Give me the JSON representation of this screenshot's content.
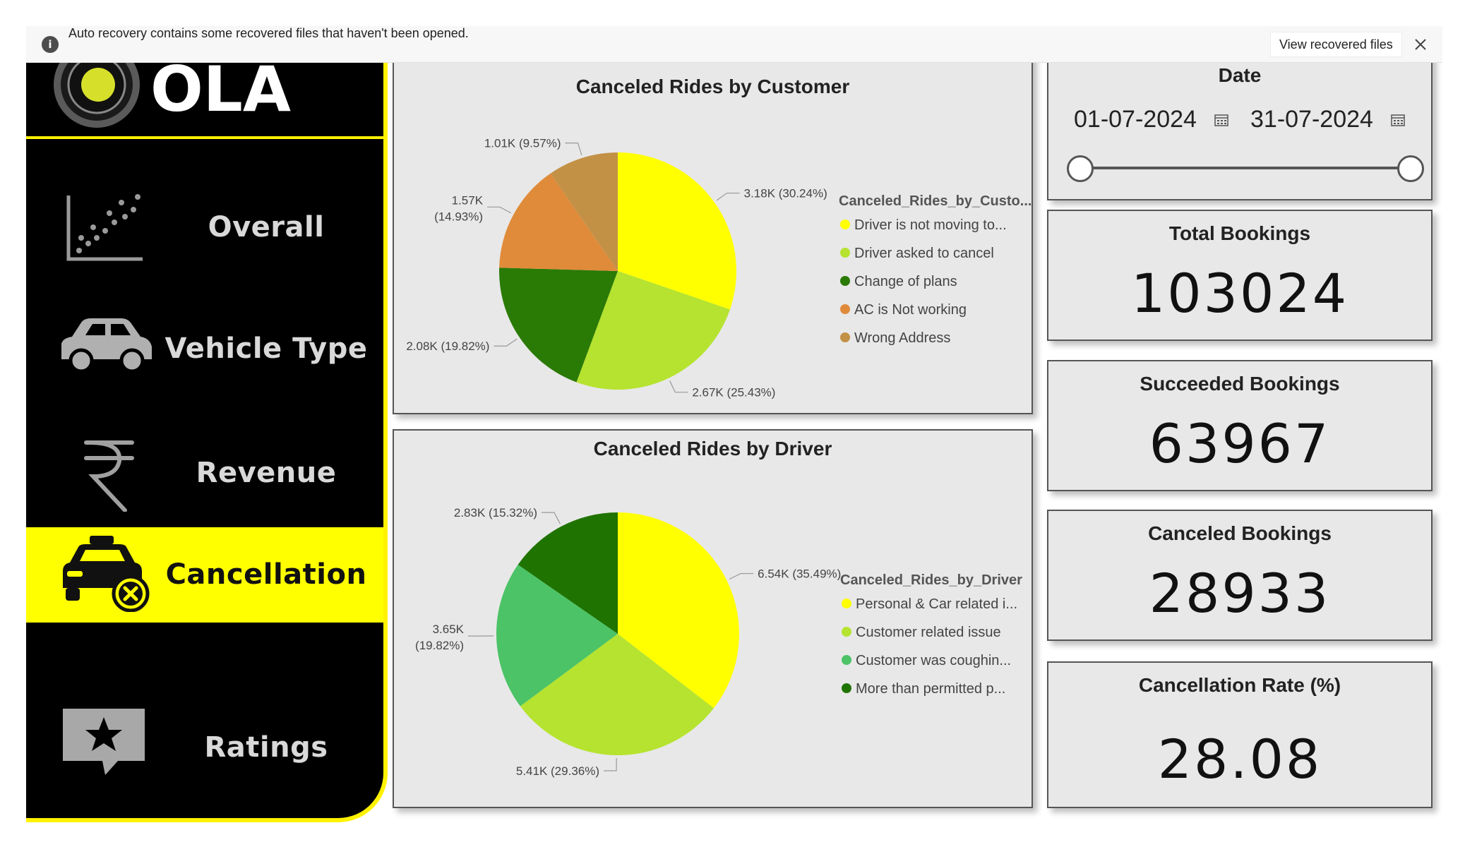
{
  "notification": {
    "message": "Auto recovery contains some recovered files that haven't been opened.",
    "view_button": "View recovered files",
    "info_glyph": "i"
  },
  "sidebar": {
    "brand": "OLA",
    "items": [
      {
        "label": "Overall",
        "icon": "scatter-chart-icon",
        "active": false
      },
      {
        "label": "Vehicle Type",
        "icon": "car-icon",
        "active": false
      },
      {
        "label": "Revenue",
        "icon": "rupee-icon",
        "active": false
      },
      {
        "label": "Cancellation",
        "icon": "taxi-cancel-icon",
        "active": true
      },
      {
        "label": "Ratings",
        "icon": "star-speech-bubble-icon",
        "active": false
      }
    ]
  },
  "date_slicer": {
    "title": "Date",
    "start": "01-07-2024",
    "end": "31-07-2024"
  },
  "kpis": [
    {
      "title": "Total Bookings",
      "value": "103024"
    },
    {
      "title": "Succeeded Bookings",
      "value": "63967"
    },
    {
      "title": "Canceled Bookings",
      "value": "28933"
    },
    {
      "title": "Cancellation Rate (%)",
      "value": "28.08"
    }
  ],
  "colors": {
    "accent_yellow": "#ffff00",
    "yellow_green": "#b5e32f",
    "dark_green": "#2a7a06",
    "orange": "#e08b3a",
    "tan": "#c39146",
    "medium_green": "#4cc366",
    "darker_green": "#1f7300"
  },
  "chart_data": [
    {
      "type": "pie",
      "title": "Canceled Rides by Customer",
      "legend_title": "Canceled_Rides_by_Custo...",
      "legend_position": "right",
      "slices": [
        {
          "name": "Driver is not moving to...",
          "value": 3180,
          "label": "3.18K (30.24%)",
          "percent": 30.24,
          "color": "#ffff00"
        },
        {
          "name": "Driver asked to cancel",
          "value": 2670,
          "label": "2.67K (25.43%)",
          "percent": 25.43,
          "color": "#b5e32f"
        },
        {
          "name": "Change of plans",
          "value": 2080,
          "label": "2.08K (19.82%)",
          "percent": 19.82,
          "color": "#2a7a06"
        },
        {
          "name": "AC is Not working",
          "value": 1570,
          "label_line1": "1.57K",
          "label_line2": "(14.93%)",
          "percent": 14.93,
          "color": "#e08b3a"
        },
        {
          "name": "Wrong Address",
          "value": 1010,
          "label": "1.01K (9.57%)",
          "percent": 9.57,
          "color": "#c39146"
        }
      ]
    },
    {
      "type": "pie",
      "title": "Canceled Rides by Driver",
      "legend_title": "Canceled_Rides_by_Driver",
      "legend_position": "right",
      "slices": [
        {
          "name": "Personal & Car related i...",
          "value": 6540,
          "label": "6.54K (35.49%)",
          "percent": 35.49,
          "color": "#ffff00"
        },
        {
          "name": "Customer related issue",
          "value": 5410,
          "label": "5.41K (29.36%)",
          "percent": 29.36,
          "color": "#b5e32f"
        },
        {
          "name": "Customer was coughin...",
          "value": 3650,
          "label_line1": "3.65K",
          "label_line2": "(19.82%)",
          "percent": 19.82,
          "color": "#4cc366"
        },
        {
          "name": "More than permitted p...",
          "value": 2830,
          "label": "2.83K (15.32%)",
          "percent": 15.32,
          "color": "#1f7300"
        }
      ]
    }
  ]
}
